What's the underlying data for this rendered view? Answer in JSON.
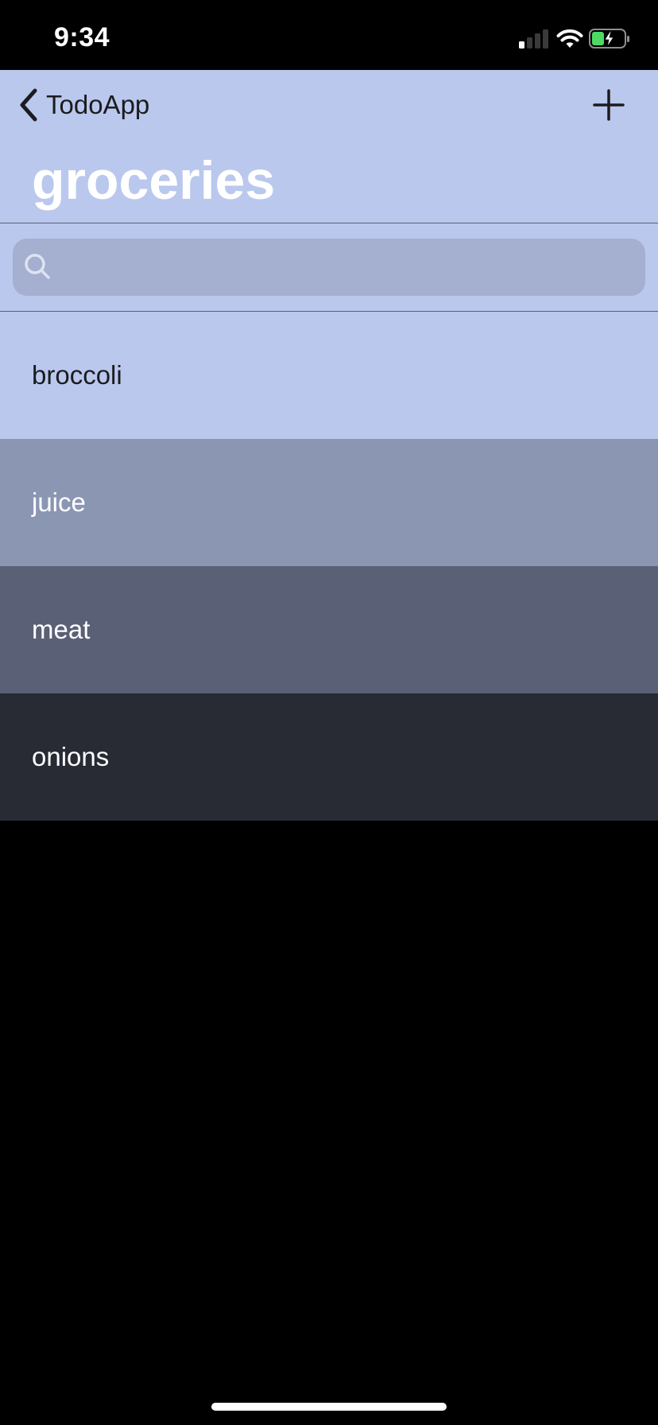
{
  "status_bar": {
    "time": "9:34",
    "icons": [
      "cellular-signal-icon",
      "wifi-icon",
      "battery-charging-icon"
    ],
    "battery_color": "#4cd964"
  },
  "nav": {
    "back_label": "TodoApp",
    "back_icon": "chevron-left-icon",
    "add_icon": "plus-icon",
    "title": "groceries",
    "background": "#bac8ee"
  },
  "search": {
    "icon": "search-icon",
    "value": "",
    "placeholder": ""
  },
  "items": [
    {
      "label": "broccoli",
      "background": "#bac8ee",
      "text_color": "#1c1c1e"
    },
    {
      "label": "juice",
      "background": "#8b96b3",
      "text_color": "#ffffff"
    },
    {
      "label": "meat",
      "background": "#5a6075",
      "text_color": "#ffffff"
    },
    {
      "label": "onions",
      "background": "#282b34",
      "text_color": "#ffffff"
    }
  ]
}
